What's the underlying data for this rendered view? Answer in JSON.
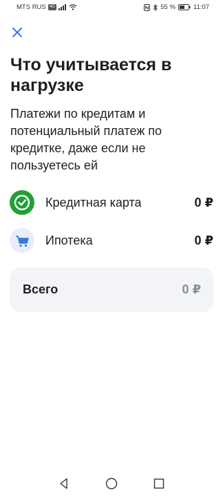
{
  "status_bar": {
    "carrier": "MTS RUS",
    "network_badge": "4G",
    "battery_percent": "55 %",
    "time": "11:07"
  },
  "header": {
    "close_icon": "close-icon"
  },
  "content": {
    "title": "Что учитывается в нагрузке",
    "subtitle": "Платежи по кредитам и потенциальный платеж по кредитке, даже если не пользуетесь ей"
  },
  "items": [
    {
      "label": "Кредитная карта",
      "value": "0 ₽",
      "icon": "credit-card-check-icon",
      "icon_color": "#21a038"
    },
    {
      "label": "Ипотека",
      "value": "0 ₽",
      "icon": "cart-icon",
      "icon_color": "#3a7ae0"
    }
  ],
  "total": {
    "label": "Всего",
    "value": "0 ₽"
  },
  "nav": {
    "back": "back-triangle-icon",
    "home": "home-circle-icon",
    "recents": "recents-square-icon"
  },
  "colors": {
    "accent_blue": "#3a7ae0",
    "green": "#21a038",
    "card_bg": "#f2f4f7",
    "muted_text": "#8a9099"
  }
}
